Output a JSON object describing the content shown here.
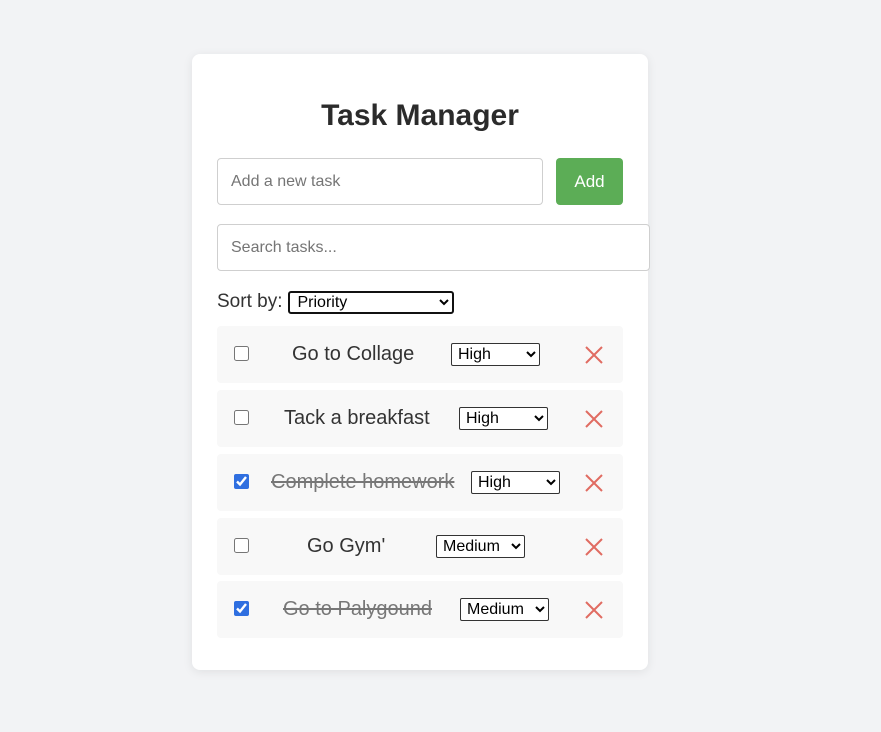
{
  "app": {
    "title": "Task Manager"
  },
  "new_task": {
    "placeholder": "Add a new task",
    "value": "",
    "add_label": "Add"
  },
  "search": {
    "placeholder": "Search tasks...",
    "value": ""
  },
  "sort": {
    "label": "Sort by:",
    "selected": "Priority"
  },
  "tasks": [
    {
      "name": "Go to Collage",
      "completed": false,
      "priority": "High"
    },
    {
      "name": "Tack a breakfast",
      "completed": false,
      "priority": "High"
    },
    {
      "name": "Complete homework",
      "completed": true,
      "priority": "High"
    },
    {
      "name": "Go Gym'",
      "completed": false,
      "priority": "Medium"
    },
    {
      "name": "Go to Palygound",
      "completed": true,
      "priority": "Medium"
    }
  ],
  "icons": {
    "delete": "close-icon"
  },
  "colors": {
    "add_button": "#5cad56",
    "delete_icon": "#e06c62",
    "checkbox_checked": "#2f6fe0",
    "background": "#f2f3f5"
  }
}
